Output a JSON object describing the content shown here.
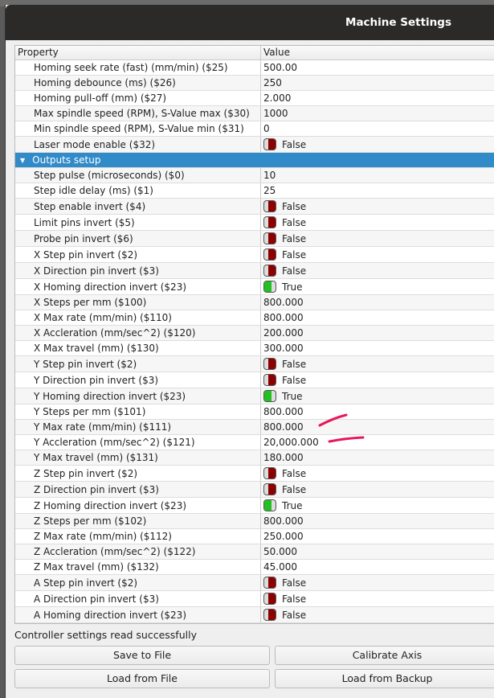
{
  "window": {
    "title": "Machine Settings"
  },
  "table": {
    "headers": [
      "Property",
      "Value"
    ],
    "rows": [
      {
        "p": "Homing seek rate (fast) (mm/min) ($25)",
        "v": "500.00"
      },
      {
        "p": "Homing debounce (ms) ($26)",
        "v": "250"
      },
      {
        "p": "Homing pull-off (mm) ($27)",
        "v": "2.000"
      },
      {
        "p": "Max spindle speed (RPM), S-Value max ($30)",
        "v": "1000"
      },
      {
        "p": "Min spindle speed (RPM), S-Value min ($31)",
        "v": "0"
      },
      {
        "p": "Laser mode enable ($32)",
        "v": "False",
        "bool": false
      },
      {
        "group": "Outputs setup"
      },
      {
        "p": "Step pulse (microseconds) ($0)",
        "v": "10"
      },
      {
        "p": "Step idle delay (ms) ($1)",
        "v": "25"
      },
      {
        "p": "Step enable invert ($4)",
        "v": "False",
        "bool": false
      },
      {
        "p": "Limit pins invert ($5)",
        "v": "False",
        "bool": false
      },
      {
        "p": "Probe pin invert ($6)",
        "v": "False",
        "bool": false
      },
      {
        "p": "X Step pin invert ($2)",
        "v": "False",
        "bool": false
      },
      {
        "p": "X Direction pin invert ($3)",
        "v": "False",
        "bool": false
      },
      {
        "p": "X Homing direction invert ($23)",
        "v": "True",
        "bool": true
      },
      {
        "p": "X Steps per mm ($100)",
        "v": "800.000"
      },
      {
        "p": "X Max rate (mm/min) ($110)",
        "v": "800.000"
      },
      {
        "p": "X Accleration (mm/sec^2) ($120)",
        "v": "200.000"
      },
      {
        "p": "X Max travel (mm) ($130)",
        "v": "300.000"
      },
      {
        "p": "Y Step pin invert ($2)",
        "v": "False",
        "bool": false
      },
      {
        "p": "Y Direction pin invert ($3)",
        "v": "False",
        "bool": false
      },
      {
        "p": "Y Homing direction invert ($23)",
        "v": "True",
        "bool": true
      },
      {
        "p": "Y Steps per mm ($101)",
        "v": "800.000"
      },
      {
        "p": "Y Max rate (mm/min) ($111)",
        "v": "800.000"
      },
      {
        "p": "Y Accleration (mm/sec^2) ($121)",
        "v": "20,000.000"
      },
      {
        "p": "Y Max travel (mm) ($131)",
        "v": "180.000"
      },
      {
        "p": "Z Step pin invert ($2)",
        "v": "False",
        "bool": false
      },
      {
        "p": "Z Direction pin invert ($3)",
        "v": "False",
        "bool": false
      },
      {
        "p": "Z Homing direction invert ($23)",
        "v": "True",
        "bool": true
      },
      {
        "p": "Z Steps per mm ($102)",
        "v": "800.000"
      },
      {
        "p": "Z Max rate (mm/min) ($112)",
        "v": "250.000"
      },
      {
        "p": "Z Accleration (mm/sec^2) ($122)",
        "v": "50.000"
      },
      {
        "p": "Z Max travel (mm) ($132)",
        "v": "45.000"
      },
      {
        "p": "A Step pin invert ($2)",
        "v": "False",
        "bool": false
      },
      {
        "p": "A Direction pin invert ($3)",
        "v": "False",
        "bool": false
      },
      {
        "p": "A Homing direction invert ($23)",
        "v": "False",
        "bool": false
      }
    ]
  },
  "status": "Controller settings read successfully",
  "buttons": {
    "save": "Save to File",
    "calibrate": "Calibrate Axis",
    "load": "Load from File",
    "backup": "Load from Backup"
  },
  "colors": {
    "selection": "#308bc8",
    "toggle_off": "#8b0000",
    "toggle_on": "#22c022",
    "annotation": "#e8185a"
  }
}
